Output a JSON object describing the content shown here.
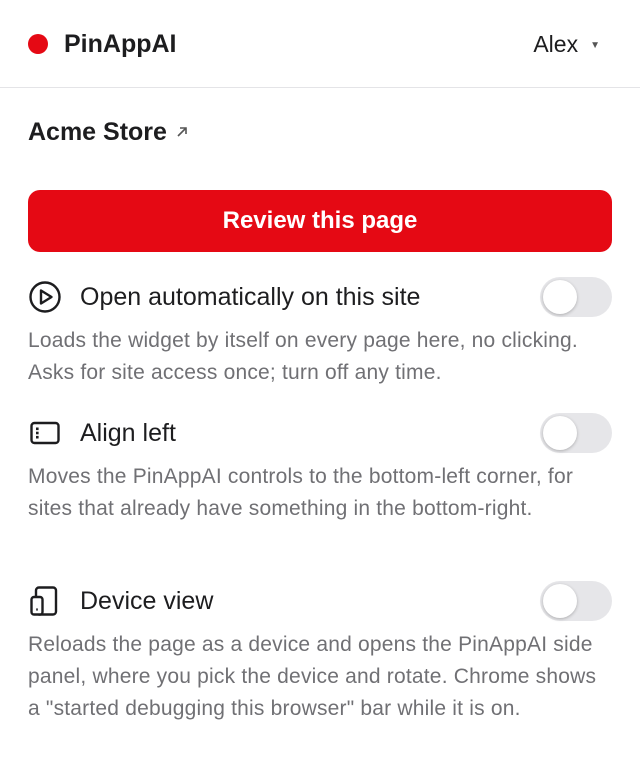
{
  "header": {
    "app_name": "PinAppAI",
    "brand_color": "#e50914",
    "user_name": "Alex",
    "user_caret_icon": "caret-down-icon"
  },
  "site": {
    "name": "Acme Store",
    "link_icon": "external-link-icon"
  },
  "review_button": {
    "label": "Review this page"
  },
  "options": [
    {
      "icon": "play-circle-icon",
      "label": "Open automatically on this site",
      "description": "Loads the widget by itself on every page here, no clicking. Asks for site access once; turn off any time.",
      "enabled": false
    },
    {
      "icon": "panel-left-icon",
      "label": "Align left",
      "description": "Moves the PinAppAI controls to the bottom-left corner, for sites that already have something in the bottom-right.",
      "enabled": false
    },
    {
      "icon": "device-icon",
      "label": "Device view",
      "description": "Reloads the page as a device and opens the PinAppAI side panel, where you pick the device and rotate. Chrome shows a \"started debugging this browser\" bar while it is on.",
      "enabled": false
    }
  ]
}
